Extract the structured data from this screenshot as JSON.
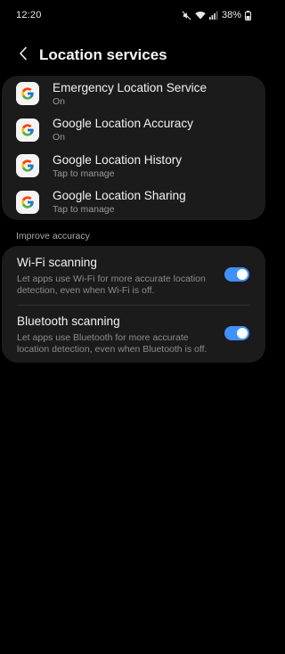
{
  "status_bar": {
    "time": "12:20",
    "battery": "38%",
    "icons": [
      "mute-icon",
      "wifi-icon",
      "signal-icon",
      "battery-icon"
    ]
  },
  "header": {
    "title": "Location services",
    "back_icon": "back-arrow-icon"
  },
  "services": [
    {
      "icon": "google-icon",
      "title": "Emergency Location Service",
      "subtitle": "On"
    },
    {
      "icon": "google-icon",
      "title": "Google Location Accuracy",
      "subtitle": "On"
    },
    {
      "icon": "google-icon",
      "title": "Google Location History",
      "subtitle": "Tap to manage"
    },
    {
      "icon": "google-icon",
      "title": "Google Location Sharing",
      "subtitle": "Tap to manage"
    }
  ],
  "improve_accuracy": {
    "header": "Improve accuracy",
    "items": [
      {
        "title": "Wi-Fi scanning",
        "description": "Let apps use Wi-Fi for more accurate location detection, even when Wi-Fi is off.",
        "enabled": true
      },
      {
        "title": "Bluetooth scanning",
        "description": "Let apps use Bluetooth for more accurate location detection, even when Bluetooth is off.",
        "enabled": true
      }
    ]
  },
  "colors": {
    "background": "#000000",
    "card": "#1b1b1b",
    "toggle_on": "#3e91ff",
    "primary_text": "#f2f2f2",
    "secondary_text": "#9a9a9a"
  }
}
